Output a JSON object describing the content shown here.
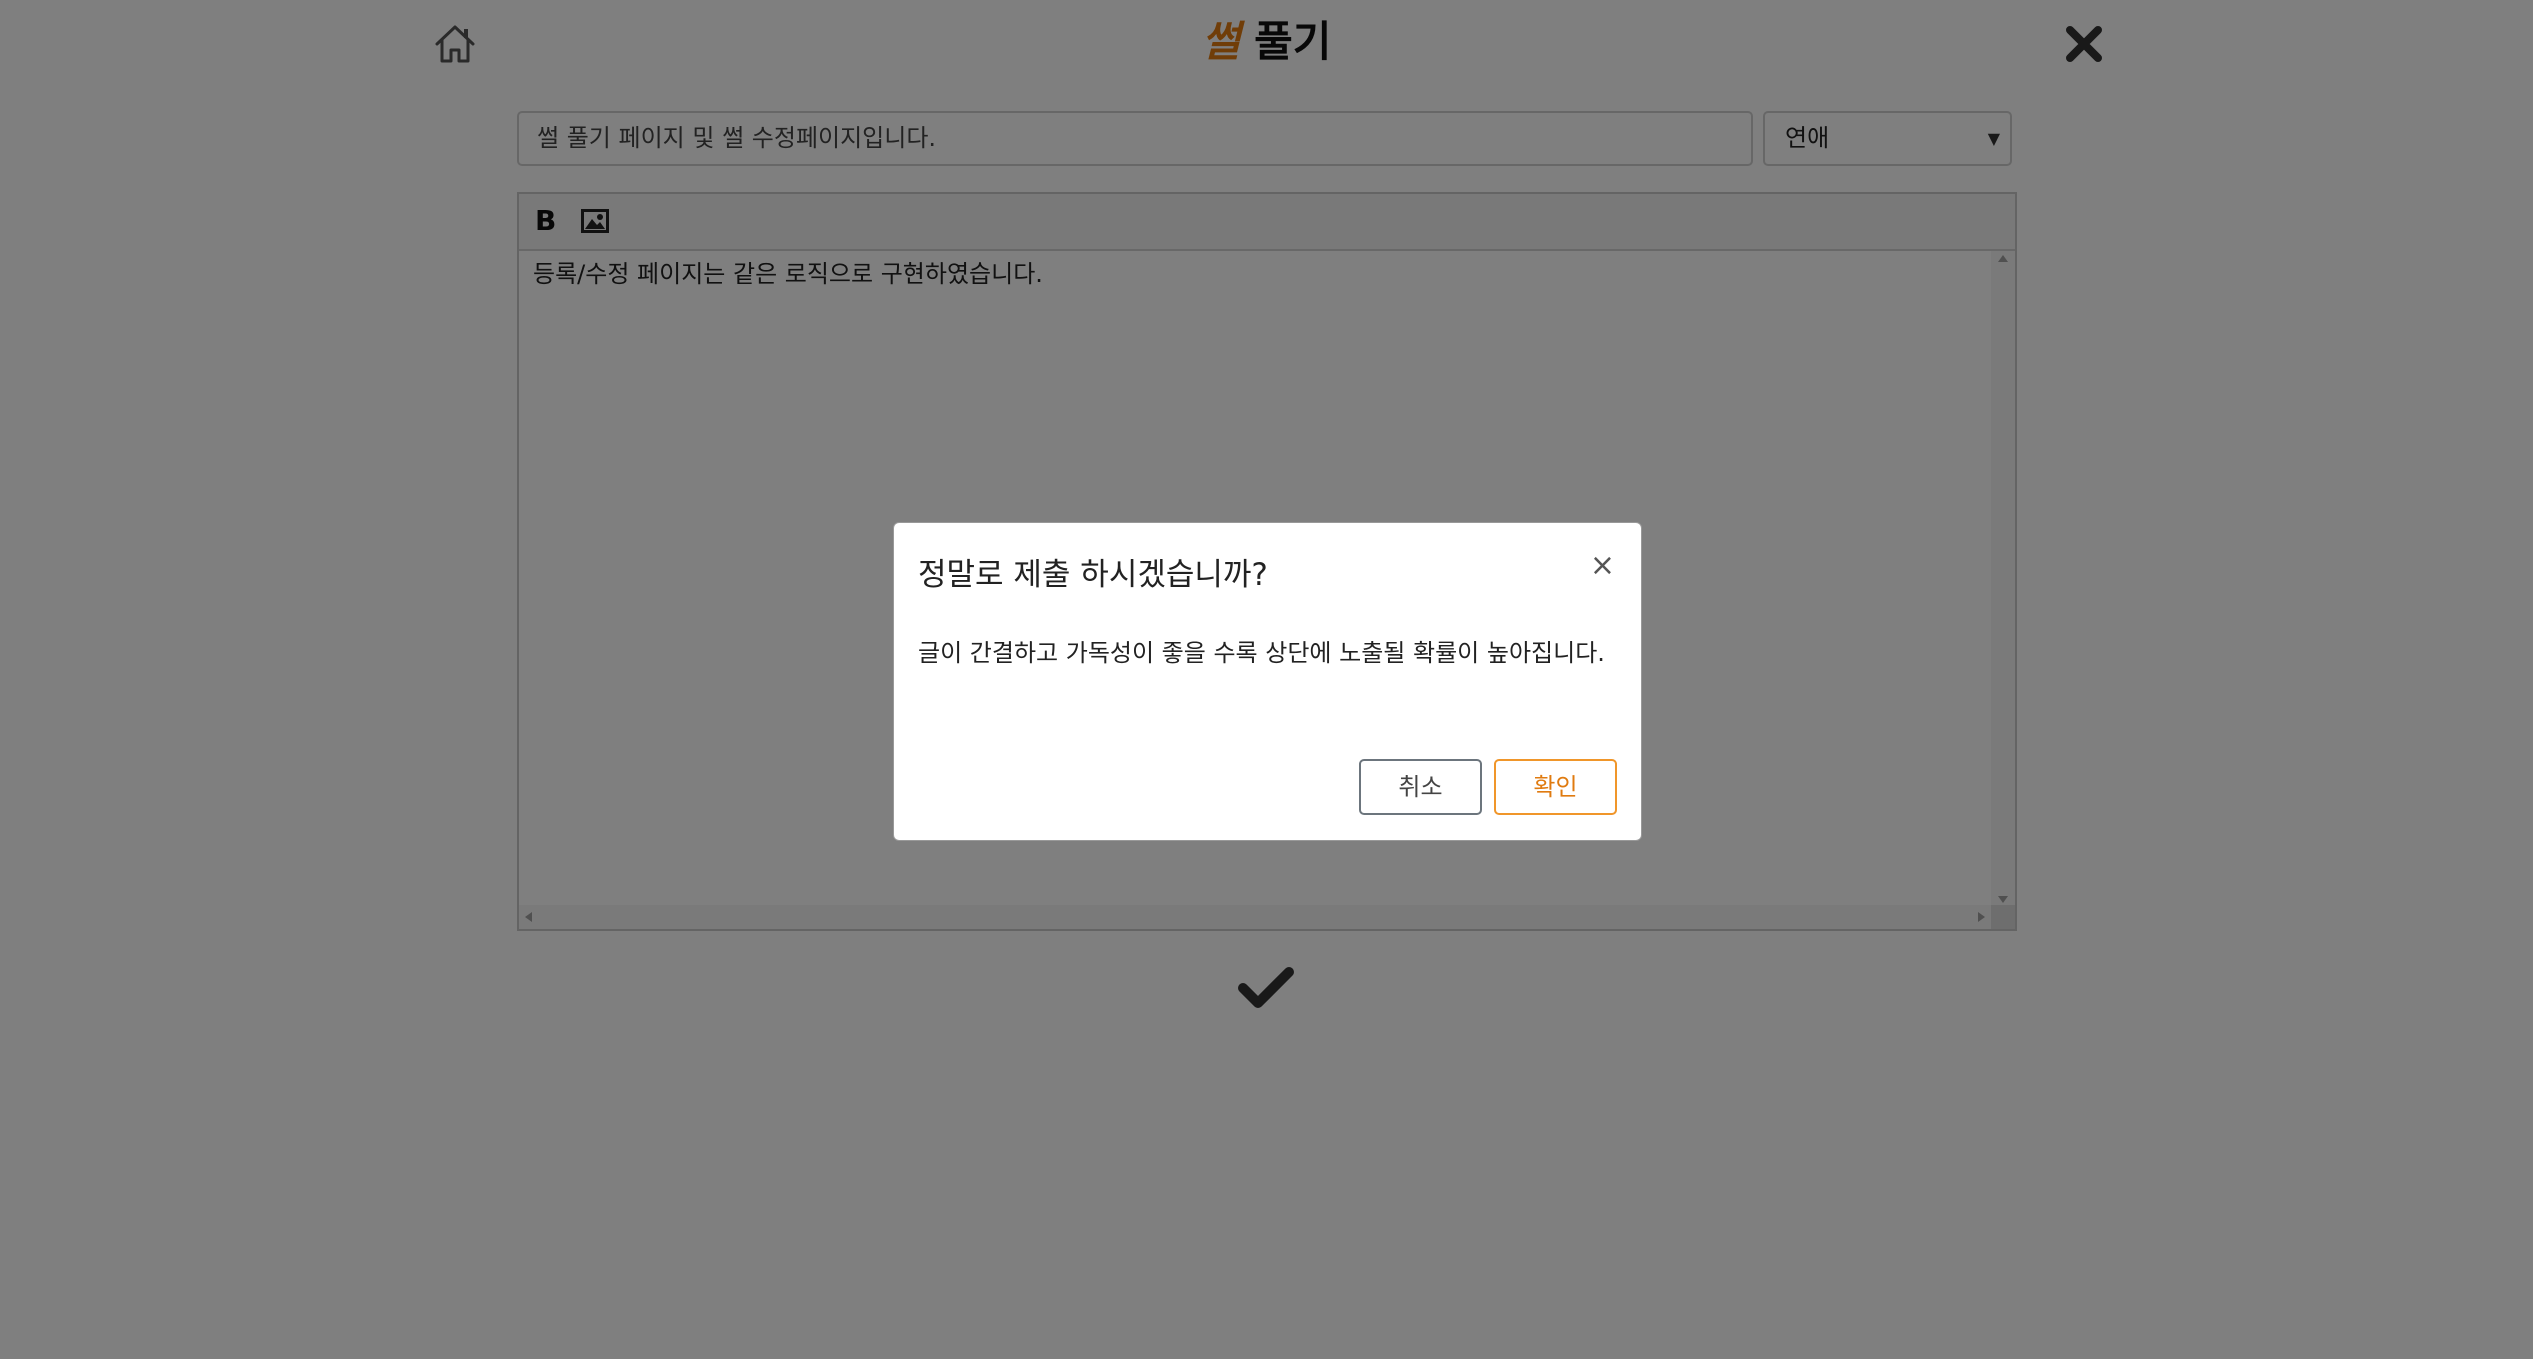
{
  "header": {
    "title_accent": "썰",
    "title_rest": "풀기",
    "home_icon": "home-icon",
    "close_icon": "close-icon"
  },
  "form": {
    "title_input_value": "썰 풀기 페이지 및 썰 수정페이지입니다.",
    "category_selected": "연애"
  },
  "editor": {
    "toolbar": {
      "bold_label": "B",
      "image_icon": "image-icon"
    },
    "content": "등록/수정 페이지는 같은 로직으로 구현하였습니다."
  },
  "submit": {
    "icon": "check-icon"
  },
  "modal": {
    "title": "정말로 제출 하시겠습니까?",
    "close_symbol": "×",
    "body": "글이 간결하고 가독성이 좋을 수록 상단에 노출될 확률이 높아집니다.",
    "cancel_label": "취소",
    "confirm_label": "확인"
  },
  "colors": {
    "accent": "#e07b10",
    "overlay": "rgba(0,0,0,0.5)"
  }
}
